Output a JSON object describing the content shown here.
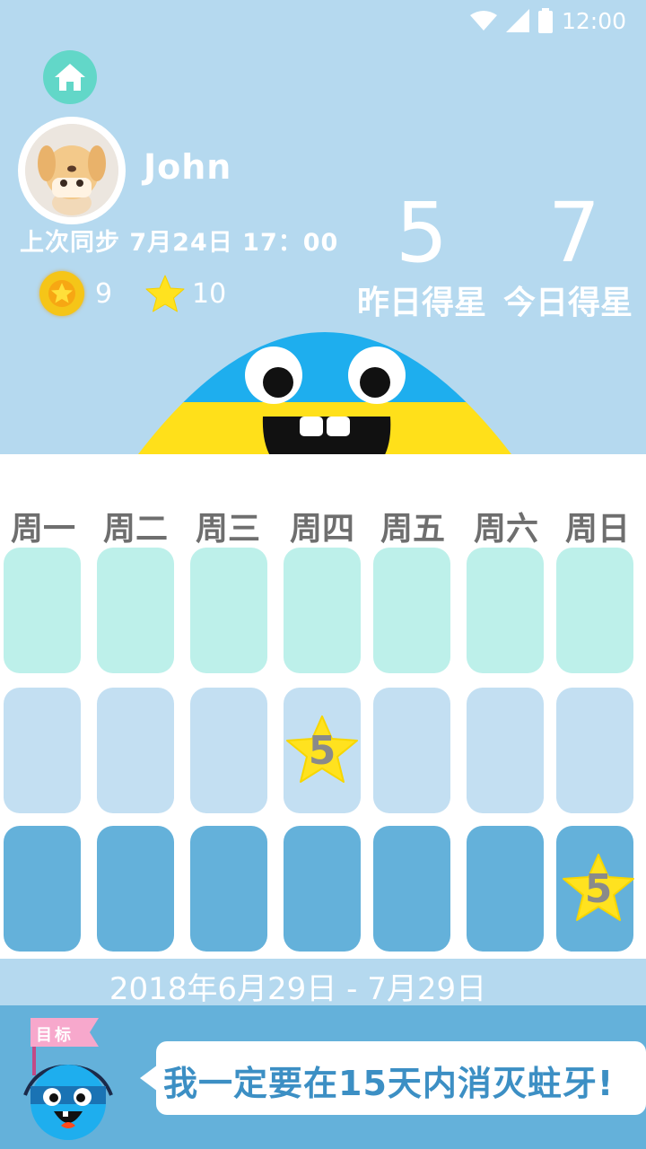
{
  "status_bar": {
    "time": "12:00",
    "icons": [
      "wifi-icon",
      "signal-icon",
      "battery-icon"
    ]
  },
  "profile": {
    "name": "John",
    "last_sync": "上次同步 7月24日 17：00",
    "coins": "9",
    "stars": "10"
  },
  "scores": {
    "yesterday_value": "5",
    "yesterday_label": "昨日得星",
    "today_value": "7",
    "today_label": "今日得星"
  },
  "calendar": {
    "weekdays": [
      "周一",
      "周二",
      "周三",
      "周四",
      "周五",
      "周六",
      "周日"
    ],
    "rewards": [
      {
        "row": 2,
        "day": "周四",
        "stars": "5"
      },
      {
        "row": 3,
        "day": "周日",
        "stars": "5"
      }
    ],
    "date_range": "2018年6月29日 - 7月29日"
  },
  "goal": {
    "flag_label": "目标",
    "text": "我一定要在15天内消灭蛀牙!"
  },
  "colors": {
    "sky": "#b5d9ef",
    "row1": "#bdf0ea",
    "row2": "#c3dff2",
    "row3": "#64b1da",
    "star": "#ffe21f",
    "accent": "#3c8fc4"
  }
}
